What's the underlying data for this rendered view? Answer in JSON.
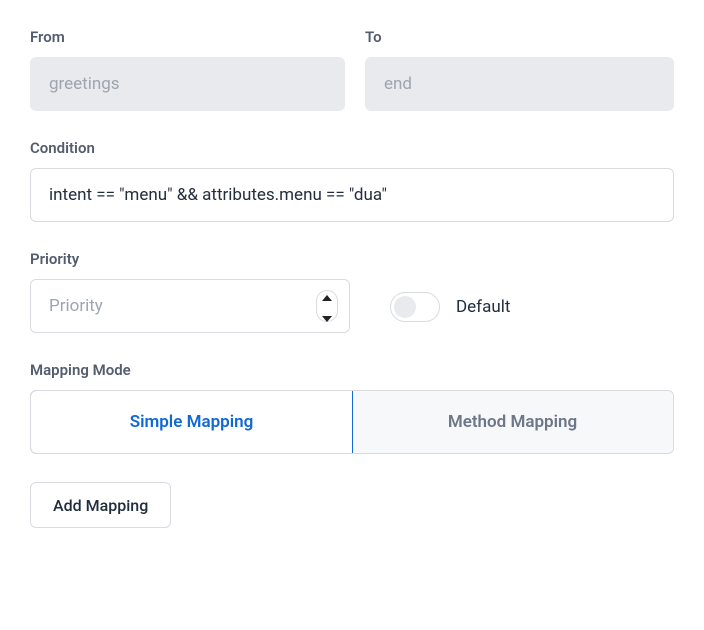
{
  "from": {
    "label": "From",
    "value": "greetings"
  },
  "to": {
    "label": "To",
    "value": "end"
  },
  "condition": {
    "label": "Condition",
    "value": "intent == \"menu\" && attributes.menu == \"dua\""
  },
  "priority": {
    "label": "Priority",
    "placeholder": "Priority",
    "value": ""
  },
  "defaultToggle": {
    "label": "Default",
    "on": false
  },
  "mappingMode": {
    "label": "Mapping Mode",
    "tabs": [
      {
        "label": "Simple Mapping",
        "active": true
      },
      {
        "label": "Method Mapping",
        "active": false
      }
    ]
  },
  "addMapping": {
    "label": "Add Mapping"
  }
}
